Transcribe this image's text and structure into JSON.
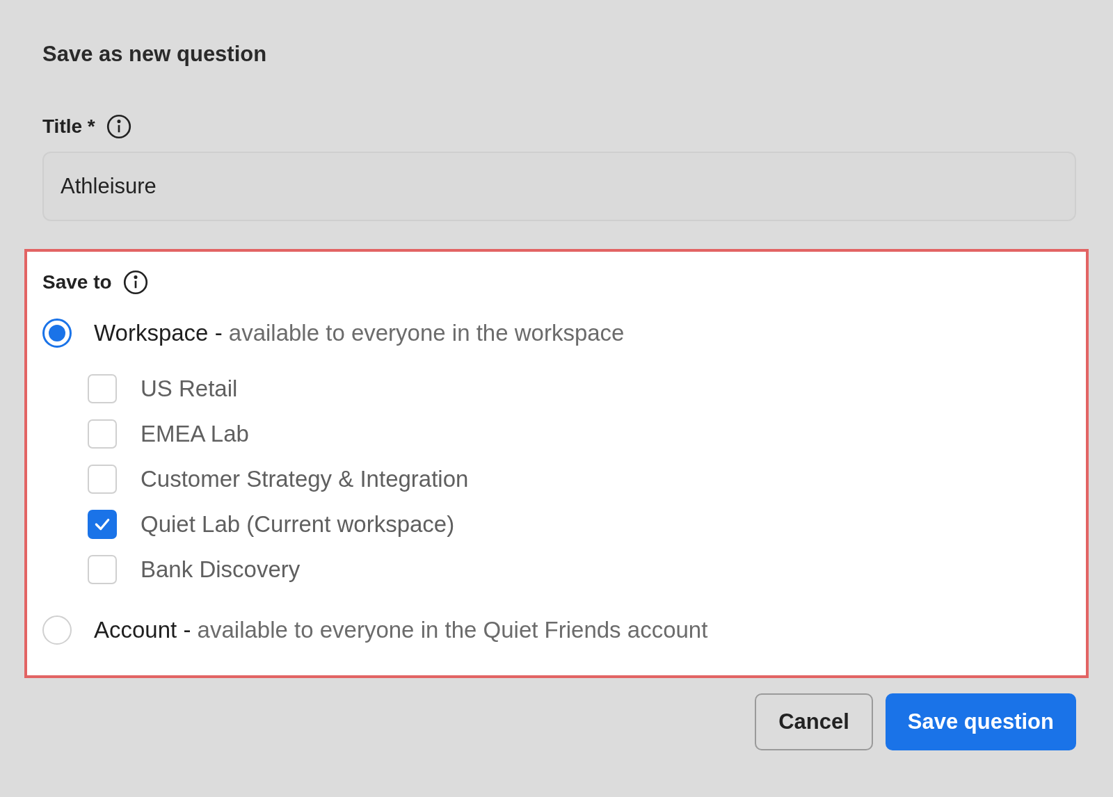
{
  "heading": "Save as new question",
  "title_field": {
    "label": "Title *",
    "value": "Athleisure"
  },
  "save_to": {
    "label": "Save to",
    "options": [
      {
        "name": "Workspace",
        "separator": "-",
        "description": "available to everyone in the workspace",
        "selected": true,
        "children": [
          {
            "label": "US Retail",
            "checked": false
          },
          {
            "label": "EMEA Lab",
            "checked": false
          },
          {
            "label": "Customer Strategy & Integration",
            "checked": false
          },
          {
            "label": "Quiet Lab (Current workspace)",
            "checked": true
          },
          {
            "label": "Bank Discovery",
            "checked": false
          }
        ]
      },
      {
        "name": "Account",
        "separator": "-",
        "description": "available to everyone in the Quiet Friends account",
        "selected": false
      }
    ]
  },
  "buttons": [
    {
      "label": "Cancel",
      "kind": "secondary"
    },
    {
      "label": "Save question",
      "kind": "primary"
    }
  ]
}
